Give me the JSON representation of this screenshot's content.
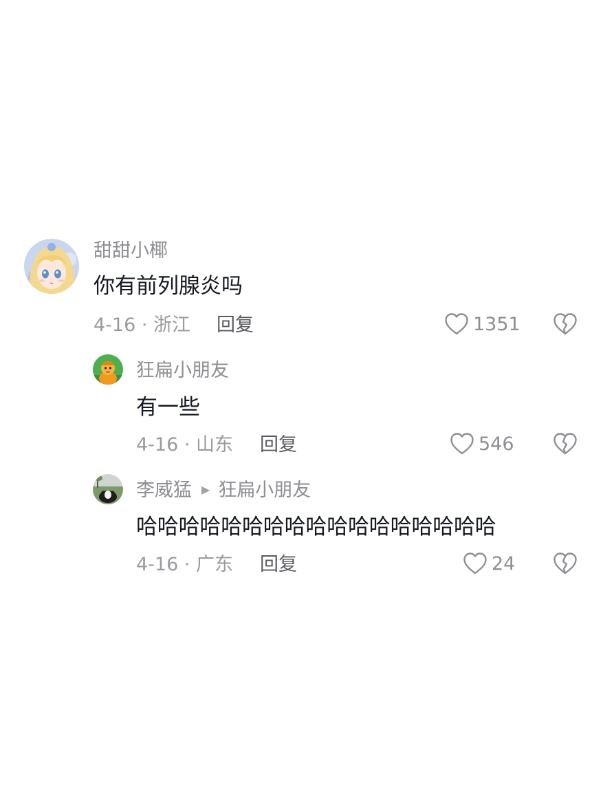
{
  "comments": [
    {
      "username": "甜甜小椰",
      "text": "你有前列腺炎吗",
      "meta": "4-16 · 浙江",
      "reply_label": "回复",
      "likes": "1351",
      "avatar": "anime-girl-avatar"
    },
    {
      "username": "狂扁小朋友",
      "text": "有一些",
      "meta": "4-16 · 山东",
      "reply_label": "回复",
      "likes": "546",
      "avatar": "cartoon-character-avatar"
    },
    {
      "username": "李威猛",
      "reply_to": "狂扁小朋友",
      "text": "哈哈哈哈哈哈哈哈哈哈哈哈哈哈哈哈哈",
      "meta": "4-16 · 广东",
      "reply_label": "回复",
      "likes": "24",
      "avatar": "dog-photo-avatar"
    }
  ],
  "colors": {
    "username": "#8e8e93",
    "text": "#161823",
    "meta": "#9a9a9f",
    "reply_button": "#5a5a60"
  },
  "icons": {
    "like": "heart-outline-icon",
    "dislike": "broken-heart-icon",
    "reply_arrow": "triangle-right-icon"
  }
}
